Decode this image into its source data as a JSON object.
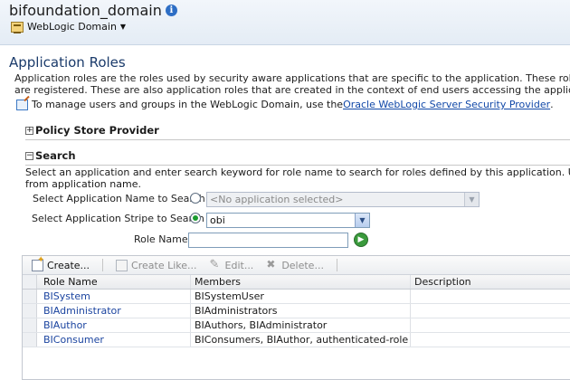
{
  "header": {
    "domain_title": "bifoundation_domain",
    "domain_menu_label": "WebLogic Domain"
  },
  "page": {
    "title": "Application Roles",
    "description_line1": "Application roles are the roles used by security aware applications that are specific to the application. These roles are seeded by",
    "description_line2": "are registered. These are also application roles that are created in the context of end users accessing the application.",
    "manage_text": "To manage users and groups in the WebLogic Domain, use the ",
    "manage_link": "Oracle WebLogic Server Security Provider",
    "manage_suffix": "."
  },
  "sections": {
    "policy_store": {
      "label": "Policy Store Provider",
      "toggle": "+"
    },
    "search": {
      "label": "Search",
      "toggle": "−"
    }
  },
  "search": {
    "desc_line1": "Select an application and enter search keyword for role name to search for roles defined by this application. Use application st",
    "desc_line2": "from application name.",
    "app_name_label": "Select Application Name to Search",
    "app_name_placeholder": "<No application selected>",
    "app_stripe_label": "Select Application Stripe to Search",
    "app_stripe_value": "obi",
    "role_name_label": "Role Name",
    "role_name_value": "",
    "app_name_selected": false,
    "app_stripe_selected": true
  },
  "toolbar": {
    "create": "Create...",
    "create_like": "Create Like...",
    "edit": "Edit...",
    "delete": "Delete..."
  },
  "table": {
    "columns": [
      "Role Name",
      "Members",
      "Description"
    ],
    "rows": [
      {
        "name": "BISystem",
        "members": "BISystemUser",
        "description": ""
      },
      {
        "name": "BIAdministrator",
        "members": "BIAdministrators",
        "description": ""
      },
      {
        "name": "BIAuthor",
        "members": "BIAuthors, BIAdministrator",
        "description": ""
      },
      {
        "name": "BIConsumer",
        "members": "BIConsumers, BIAuthor, authenticated-role",
        "description": ""
      }
    ]
  },
  "icons": {
    "info": "info-icon",
    "domain": "weblogic-domain-icon",
    "manage": "manage-link-icon",
    "create": "create-icon",
    "create_like": "create-like-icon",
    "edit": "edit-icon",
    "delete": "delete-icon",
    "go": "search-go-icon"
  },
  "colors": {
    "link": "#1148a8",
    "title": "#1b3b6b",
    "go_button": "#3a9a3c"
  }
}
